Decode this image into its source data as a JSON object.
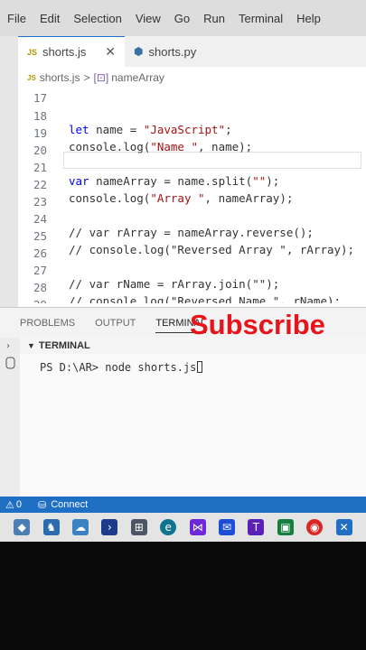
{
  "menu": [
    "File",
    "Edit",
    "Selection",
    "View",
    "Go",
    "Run",
    "Terminal",
    "Help"
  ],
  "tabs": [
    {
      "label": "shorts.js",
      "badge": "JS",
      "active": true
    },
    {
      "label": "shorts.py",
      "badge": "py",
      "active": false
    }
  ],
  "breadcrumb": {
    "file": "shorts.js",
    "badge": "JS",
    "sep": ">",
    "symbol": "nameArray"
  },
  "editor": {
    "lines": [
      {
        "num": "17",
        "code": ""
      },
      {
        "num": "18",
        "code": "let name = \"JavaScript\";"
      },
      {
        "num": "19",
        "code": "console.log(\"Name \", name);"
      },
      {
        "num": "20",
        "code": ""
      },
      {
        "num": "21",
        "code": "var nameArray = name.split(\"\");"
      },
      {
        "num": "22",
        "code": "console.log(\"Array \", nameArray);"
      },
      {
        "num": "23",
        "code": ""
      },
      {
        "num": "24",
        "code": "// var rArray = nameArray.reverse();"
      },
      {
        "num": "25",
        "code": "// console.log(\"Reversed Array \", rArray);"
      },
      {
        "num": "26",
        "code": ""
      },
      {
        "num": "27",
        "code": "// var rName = rArray.join(\"\");"
      },
      {
        "num": "28",
        "code": "// console.log(\"Reversed Name \", rName);"
      },
      {
        "num": "29",
        "code": ""
      }
    ]
  },
  "panel": {
    "tabs": [
      "PROBLEMS",
      "OUTPUT",
      "TERMINAL"
    ],
    "overlay": "Subscribe",
    "terminal_title": "TERMINAL",
    "prompt": "PS D:\\AR> node shorts.js"
  },
  "status": {
    "errors": "0",
    "connect": "Connect"
  },
  "colors": {
    "accent": "#1f6fc4",
    "subscribe": "#e8141b"
  }
}
